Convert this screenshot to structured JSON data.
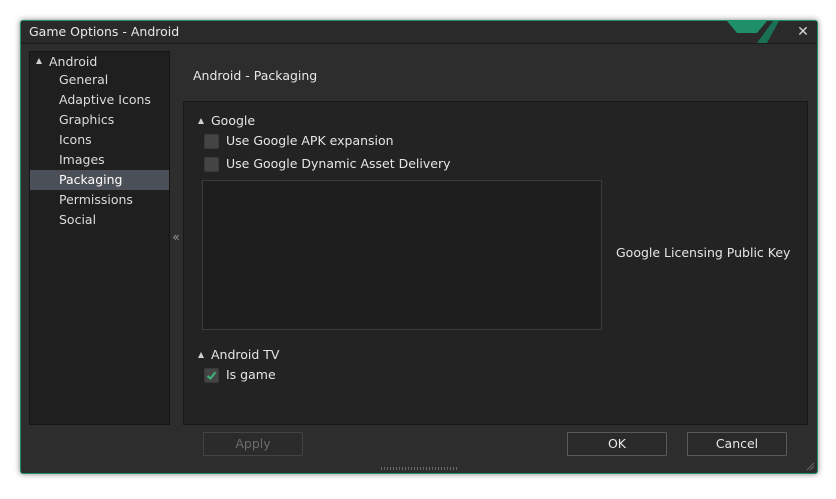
{
  "window": {
    "title": "Game Options - Android",
    "accent_color": "#1f8f6a"
  },
  "sidebar": {
    "root": "Android",
    "items": [
      {
        "label": "General"
      },
      {
        "label": "Adaptive Icons"
      },
      {
        "label": "Graphics"
      },
      {
        "label": "Icons"
      },
      {
        "label": "Images"
      },
      {
        "label": "Packaging",
        "selected": true
      },
      {
        "label": "Permissions"
      },
      {
        "label": "Social"
      }
    ]
  },
  "collapse_handle": "«",
  "page": {
    "title": "Android - Packaging"
  },
  "google": {
    "section_label": "Google",
    "apk_expansion": {
      "label": "Use Google APK expansion",
      "checked": false
    },
    "asset_delivery": {
      "label": "Use Google Dynamic Asset Delivery",
      "checked": false
    },
    "licensing_key": {
      "label": "Google Licensing Public Key",
      "value": ""
    }
  },
  "android_tv": {
    "section_label": "Android TV",
    "is_game": {
      "label": "Is game",
      "checked": true
    }
  },
  "buttons": {
    "apply": "Apply",
    "ok": "OK",
    "cancel": "Cancel"
  },
  "icons": {
    "close": "close-icon",
    "collapse": "double-chevron-left-icon",
    "expand_arrow": "triangle-expanded-icon",
    "check": "checkmark-icon"
  },
  "colors": {
    "check_color": "#3db37a",
    "selected_bg": "#4b4f57"
  }
}
